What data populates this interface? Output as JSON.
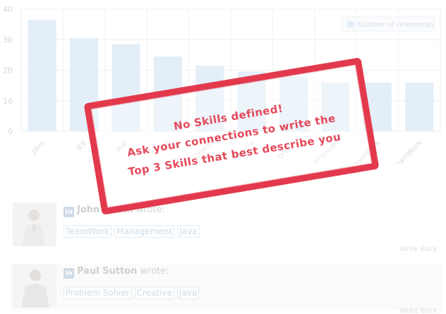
{
  "chart_data": {
    "type": "bar",
    "categories": [
      "Java",
      "JEE",
      "PHP",
      "SQL",
      "Oracle",
      "Oracle",
      "Oracle",
      "Problem Solver",
      "TeamWork",
      "TeamWork"
    ],
    "series": [
      {
        "name": "Number of references",
        "values": [
          36.5,
          30.5,
          28.5,
          24.5,
          21.5,
          19.5,
          18,
          16,
          16,
          16
        ]
      }
    ],
    "y_ticks": [
      "0",
      "10",
      "20",
      "30",
      "40"
    ],
    "ylim": [
      0,
      40
    ],
    "visible_x_labels": [
      "Java",
      "JEE",
      "PHP",
      "SQL",
      "Oracle",
      "Problem Solver",
      "TeamWork"
    ],
    "legend_position": "top-right",
    "grid": true,
    "bar_color": "#e4eef8"
  },
  "stamp": {
    "line1": "No Skills defined!",
    "line2": "Ask your connections to write the",
    "line3": "Top 3 Skills that best describe you",
    "color": "#e33a4d"
  },
  "references": [
    {
      "name": "John Smith",
      "suffix": "wrote:",
      "tags": [
        "TeamWork",
        "Management",
        "Java"
      ],
      "action": "Write Back"
    },
    {
      "name": "Paul Sutton",
      "suffix": "wrote:",
      "tags": [
        "Problem Solver",
        "Creative",
        "Java"
      ],
      "action": "Write Back"
    }
  ],
  "icons": {
    "network": "linkedin-in-icon"
  }
}
